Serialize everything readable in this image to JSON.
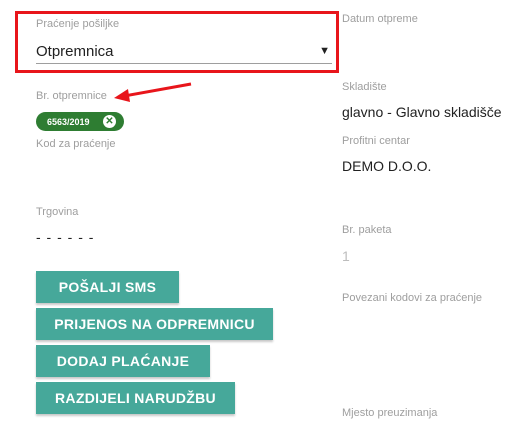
{
  "tracking": {
    "label": "Praćenje pošiljke",
    "value": "Otpremnica"
  },
  "left": {
    "delivery_note_label": "Br. otpremnice",
    "chip_text": "6563/2019",
    "tracking_code_label": "Kod za praćenje",
    "store_label": "Trgovina",
    "store_value": "- - - - - -"
  },
  "right": {
    "date_label": "Datum otpreme",
    "warehouse_label": "Skladište",
    "warehouse_value": "glavno - Glavno skladišče",
    "profit_center_label": "Profitni centar",
    "profit_center_value": "DEMO D.O.O.",
    "packages_label": "Br. paketa",
    "packages_value": "1",
    "linked_codes_label": "Povezani kodovi za praćenje",
    "pickup_label": "Mjesto preuzimanja"
  },
  "buttons": {
    "send_sms": "POŠALJI SMS",
    "transfer": "PRIJENOS NA ODPREMNICU",
    "add_payment": "DODAJ PLAĆANJE",
    "split_order": "RAZDIJELI NARUDŽBU"
  },
  "colors": {
    "accent": "#46a89a",
    "chip": "#2e7d32",
    "highlight": "#e8151b"
  }
}
